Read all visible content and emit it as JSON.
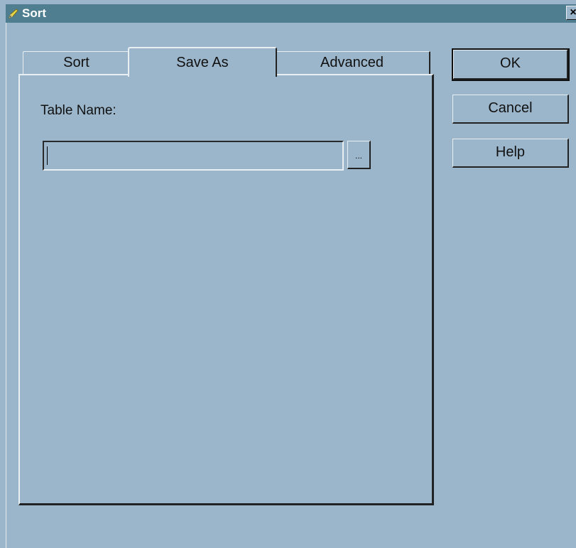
{
  "window": {
    "title": "Sort",
    "close_glyph": "×"
  },
  "tabs": [
    {
      "label": "Sort",
      "selected": false
    },
    {
      "label": "Save As",
      "selected": true
    },
    {
      "label": "Advanced",
      "selected": false
    }
  ],
  "panel": {
    "table_name_label": "Table Name:",
    "table_name_value": "",
    "browse_label": "..."
  },
  "buttons": {
    "ok": "OK",
    "cancel": "Cancel",
    "help": "Help"
  },
  "colors": {
    "dialog_background": "#9bb6cb",
    "titlebar": "#4f7e90"
  },
  "icons": {
    "title_icon": "pencil-icon"
  }
}
